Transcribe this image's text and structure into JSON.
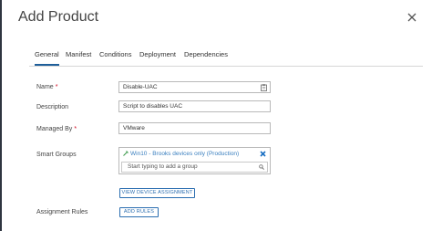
{
  "dialog": {
    "title": "Add Product"
  },
  "tabs": [
    {
      "label": "General"
    },
    {
      "label": "Manifest"
    },
    {
      "label": "Conditions"
    },
    {
      "label": "Deployment"
    },
    {
      "label": "Dependencies"
    }
  ],
  "form": {
    "name": {
      "label": "Name",
      "value": "Disable-UAC"
    },
    "description": {
      "label": "Description",
      "value": "Script to disables UAC"
    },
    "managed_by": {
      "label": "Managed By",
      "value": "VMware"
    },
    "smart_groups": {
      "label": "Smart Groups",
      "selected": "Win10 - Brooks devices only (Production)",
      "placeholder": "Start typing to add a group"
    },
    "view_assignment_button": "VIEW DEVICE ASSIGNMENT",
    "assignment_rules": {
      "label": "Assignment Rules",
      "button": "ADD RULES"
    }
  },
  "colors": {
    "accent": "#2a6db0",
    "required": "#d0021b",
    "remove": "#1a6fc2"
  },
  "icons": {
    "close": "close-icon",
    "name_field": "clipboard-icon",
    "chip": "smart-group-icon",
    "chip_remove": "remove-x-icon",
    "search": "search-icon"
  }
}
